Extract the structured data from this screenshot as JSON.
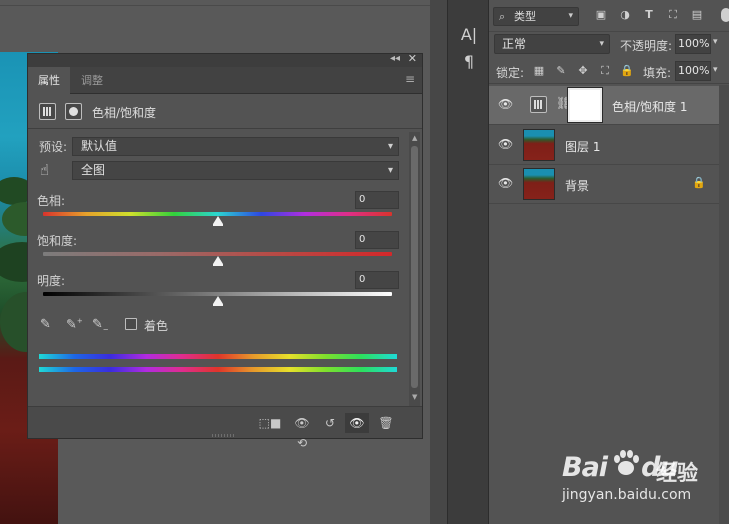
{
  "properties_panel": {
    "tab_properties": "属性",
    "tab_adjustments": "调整",
    "title": "色相/饱和度",
    "preset_label": "预设:",
    "preset_value": "默认值",
    "channel_value": "全图",
    "hue_label": "色相:",
    "hue_value": "0",
    "saturation_label": "饱和度:",
    "saturation_value": "0",
    "lightness_label": "明度:",
    "lightness_value": "0",
    "colorize_label": "着色",
    "colorize_checked": false,
    "slider_positions": {
      "hue": 0.5,
      "saturation": 0.5,
      "lightness": 0.5
    }
  },
  "layers_panel": {
    "filter_kind": "类型",
    "blend_mode": "正常",
    "opacity_label": "不透明度:",
    "opacity_value": "100%",
    "lock_label": "锁定:",
    "fill_label": "填充:",
    "fill_value": "100%",
    "layers": [
      {
        "name": "色相/饱和度 1",
        "type": "adjustment",
        "visible": true,
        "selected": true
      },
      {
        "name": "图层 1",
        "type": "pixel",
        "visible": true,
        "selected": false
      },
      {
        "name": "背景",
        "type": "background",
        "visible": true,
        "selected": false,
        "locked": true
      }
    ]
  },
  "tool_strip": {
    "icons": [
      "character-icon",
      "paragraph-icon"
    ],
    "character_glyph": "A|",
    "paragraph_glyph": "¶"
  },
  "watermark": {
    "logo_text": "Bai",
    "logo_suffix": "du",
    "brand_text": "经验",
    "url": "jingyan.baidu.com"
  },
  "colors": {
    "panel_bg": "#535353",
    "selected_row": "#696969",
    "canvas_bg": "#595959"
  }
}
